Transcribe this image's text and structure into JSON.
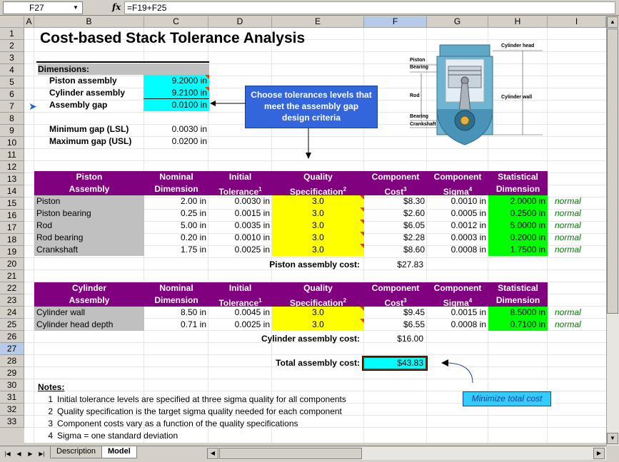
{
  "formula_bar": {
    "name_box": "F27",
    "fx": "fx",
    "formula": "=F19+F25"
  },
  "columns": [
    "A",
    "B",
    "C",
    "D",
    "E",
    "F",
    "G",
    "H",
    "I"
  ],
  "rows": [
    "1",
    "2",
    "3",
    "4",
    "5",
    "6",
    "7",
    "8",
    "9",
    "10",
    "11",
    "12",
    "13",
    "14",
    "15",
    "16",
    "17",
    "18",
    "19",
    "20",
    "21",
    "22",
    "23",
    "24",
    "25",
    "26",
    "27",
    "28",
    "29",
    "30",
    "31",
    "32",
    "33"
  ],
  "title": "Cost-based Stack Tolerance Analysis",
  "dimensions": {
    "header": "Dimensions:",
    "piston_label": "Piston assembly",
    "piston_value": "9.2000 in",
    "cylinder_label": "Cylinder assembly",
    "cylinder_value": "9.2100 in",
    "gap_label": "Assembly gap",
    "gap_value": "0.0100 in",
    "min_label": "Minimum gap (LSL)",
    "min_value": "0.0030 in",
    "max_label": "Maximum gap (USL)",
    "max_value": "0.0200 in"
  },
  "callout": "Choose tolerances levels that meet the assembly gap design criteria",
  "diagram": {
    "labels": [
      "Piston",
      "Bearing",
      "Rod",
      "Bearing",
      "Crankshaft",
      "Cylinder head",
      "Cylinder wall"
    ]
  },
  "piston_table": {
    "headers": {
      "b1": "Piston",
      "b2": "Assembly",
      "c1": "Nominal",
      "c2": "Dimension",
      "d1": "Initial",
      "d2": "Tolerance",
      "d2sup": "1",
      "e1": "Quality",
      "e2": "Specification",
      "e2sup": "2",
      "f1": "Component",
      "f2": "Cost",
      "f2sup": "3",
      "g1": "Component",
      "g2": "Sigma",
      "g2sup": "4",
      "h1": "Statistical",
      "h2": "Dimension"
    },
    "rows": [
      {
        "name": "Piston",
        "nominal": "2.00 in",
        "tol": "0.0030 in",
        "q": "3.0",
        "cost": "$8.30",
        "sigma": "0.0010 in",
        "stat": "2.0000 in",
        "dist": "normal"
      },
      {
        "name": "Piston bearing",
        "nominal": "0.25 in",
        "tol": "0.0015 in",
        "q": "3.0",
        "cost": "$2.60",
        "sigma": "0.0005 in",
        "stat": "0.2500 in",
        "dist": "normal"
      },
      {
        "name": "Rod",
        "nominal": "5.00 in",
        "tol": "0.0035 in",
        "q": "3.0",
        "cost": "$6.05",
        "sigma": "0.0012 in",
        "stat": "5.0000 in",
        "dist": "normal"
      },
      {
        "name": "Rod bearing",
        "nominal": "0.20 in",
        "tol": "0.0010 in",
        "q": "3.0",
        "cost": "$2.28",
        "sigma": "0.0003 in",
        "stat": "0.2000 in",
        "dist": "normal"
      },
      {
        "name": "Crankshaft",
        "nominal": "1.75 in",
        "tol": "0.0025 in",
        "q": "3.0",
        "cost": "$8.60",
        "sigma": "0.0008 in",
        "stat": "1.7500 in",
        "dist": "normal"
      }
    ],
    "cost_label": "Piston assembly cost:",
    "cost_value": "$27.83"
  },
  "cylinder_table": {
    "headers": {
      "b1": "Cylinder",
      "b2": "Assembly",
      "c1": "Nominal",
      "c2": "Dimension",
      "d1": "Initial",
      "d2": "Tolerance",
      "d2sup": "1",
      "e1": "Quality",
      "e2": "Specification",
      "e2sup": "2",
      "f1": "Component",
      "f2": "Cost",
      "f2sup": "3",
      "g1": "Component",
      "g2": "Sigma",
      "g2sup": "4",
      "h1": "Statistical",
      "h2": "Dimension"
    },
    "rows": [
      {
        "name": "Cylinder wall",
        "nominal": "8.50 in",
        "tol": "0.0045 in",
        "q": "3.0",
        "cost": "$9.45",
        "sigma": "0.0015 in",
        "stat": "8.5000 in",
        "dist": "normal"
      },
      {
        "name": "Cylinder head depth",
        "nominal": "0.71 in",
        "tol": "0.0025 in",
        "q": "3.0",
        "cost": "$6.55",
        "sigma": "0.0008 in",
        "stat": "0.7100 in",
        "dist": "normal"
      }
    ],
    "cost_label": "Cylinder assembly cost:",
    "cost_value": "$16.00"
  },
  "total": {
    "label": "Total assembly cost:",
    "value": "$43.83"
  },
  "minimize": "Minimize total cost",
  "notes": {
    "header": "Notes:",
    "items": [
      {
        "n": "1",
        "text": "Initial tolerance levels are specified at three sigma quality for all components"
      },
      {
        "n": "2",
        "text": "Quality specification is the target sigma quality needed for each component"
      },
      {
        "n": "3",
        "text": "Component costs vary as a function of the quality specifications"
      },
      {
        "n": "4",
        "text": "Sigma = one standard deviation"
      }
    ]
  },
  "tabs": {
    "description": "Description",
    "model": "Model"
  },
  "colors": {
    "header_purple": "#800080",
    "input_cyan": "#00ffff",
    "quality_yellow": "#ffff00",
    "stat_green": "#00ff00",
    "callout_blue": "#3366dd"
  }
}
